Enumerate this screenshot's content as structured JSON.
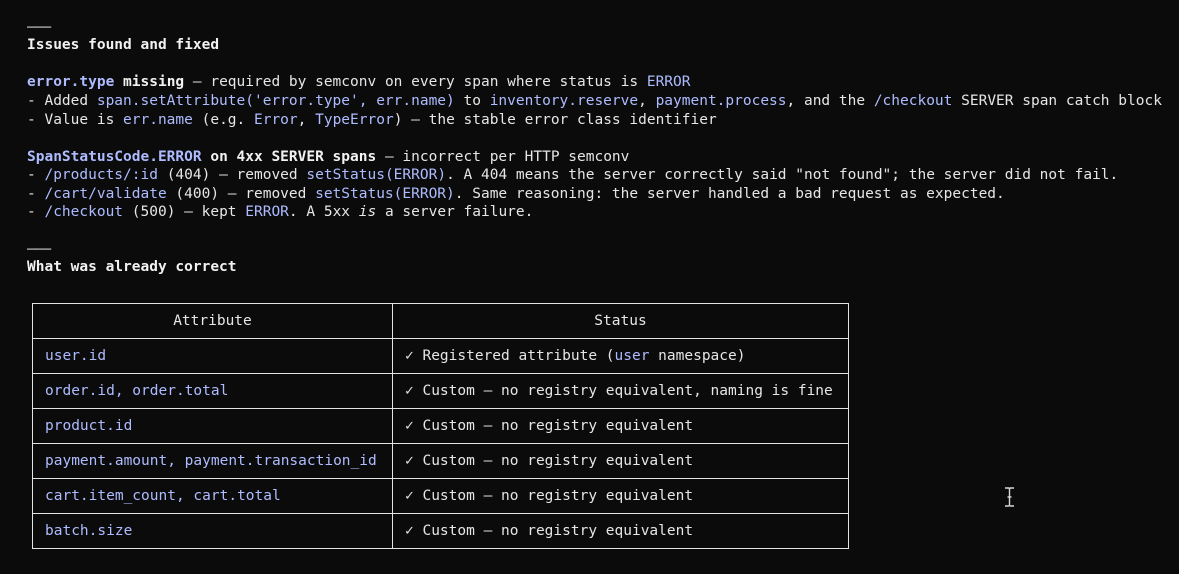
{
  "divider": "———",
  "section1": {
    "heading": "Issues found and fixed",
    "item1": {
      "title_code": "error.type",
      "title_rest": " missing",
      "desc": " — required by semconv on every span where status is ",
      "desc_code": "ERROR",
      "bullet1": {
        "prefix": "- Added ",
        "code1": "span.setAttribute('error.type', err.name)",
        "mid1": " to ",
        "code2": "inventory.reserve",
        "mid2": ", ",
        "code3": "payment.process",
        "mid3": ", and the ",
        "code4": "/checkout",
        "suffix": " SERVER span catch block"
      },
      "bullet2": {
        "prefix": "- Value is ",
        "code1": "err.name",
        "mid1": " (e.g. ",
        "code2": "Error",
        "mid2": ", ",
        "code3": "TypeError",
        "suffix": ") — the stable error class identifier"
      }
    },
    "item2": {
      "title_code": "SpanStatusCode.ERROR",
      "title_rest": " on 4xx SERVER spans",
      "desc": " — incorrect per HTTP semconv",
      "bullet1": {
        "prefix": "- ",
        "code1": "/products/:id",
        "mid1": " (404) — removed ",
        "code2": "setStatus(ERROR)",
        "suffix": ". A 404 means the server correctly said \"not found\"; the server did not fail."
      },
      "bullet2": {
        "prefix": "- ",
        "code1": "/cart/validate",
        "mid1": " (400) — removed ",
        "code2": "setStatus(ERROR)",
        "suffix": ". Same reasoning: the server handled a bad request as expected."
      },
      "bullet3": {
        "prefix": "- ",
        "code1": "/checkout",
        "mid1": " (500) — kept ",
        "code2": "ERROR",
        "mid2": ". A 5xx ",
        "italic": "is",
        "suffix": " a server failure."
      }
    }
  },
  "section2": {
    "heading": "What was already correct",
    "table": {
      "headers": [
        "Attribute",
        "Status"
      ],
      "rows": [
        {
          "attr": "user.id",
          "status_pre": "✓ Registered attribute (",
          "status_code": "user",
          "status_post": " namespace)"
        },
        {
          "attr": "order.id, order.total",
          "status_pre": "✓ Custom — no registry equivalent, naming is fine",
          "status_code": "",
          "status_post": ""
        },
        {
          "attr": "product.id",
          "status_pre": "✓ Custom — no registry equivalent",
          "status_code": "",
          "status_post": ""
        },
        {
          "attr": "payment.amount, payment.transaction_id",
          "status_pre": "✓ Custom — no registry equivalent",
          "status_code": "",
          "status_post": ""
        },
        {
          "attr": "cart.item_count, cart.total",
          "status_pre": "✓ Custom — no registry equivalent",
          "status_code": "",
          "status_post": ""
        },
        {
          "attr": "batch.size",
          "status_pre": "✓ Custom — no registry equivalent",
          "status_code": "",
          "status_post": ""
        }
      ]
    }
  },
  "colors": {
    "background": "#0b0b0c",
    "text": "#e6e6e6",
    "code": "#aebcff",
    "border": "#e4e4e4"
  },
  "cursor_icon": "text-cursor-icon"
}
